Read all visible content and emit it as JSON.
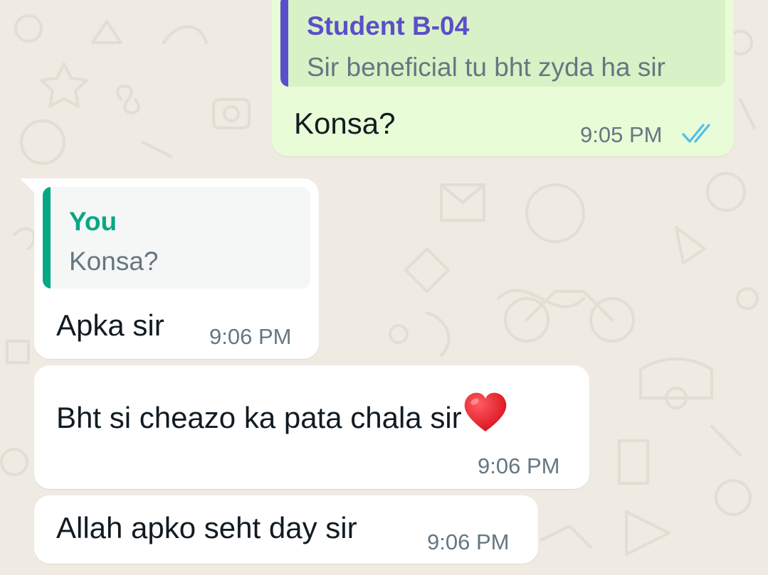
{
  "colors": {
    "wallpaper": "#efeae2",
    "outgoing_bubble": "#e7fcd7",
    "outgoing_quote_bg": "#d9f1c6",
    "incoming_bubble": "#ffffff",
    "incoming_quote_bg": "#f5f6f6",
    "quote_author_purple": "#5b4fc9",
    "quote_author_green": "#06a884",
    "read_ticks": "#53bdeb",
    "heart": "#e8202a"
  },
  "messages": [
    {
      "direction": "outgoing",
      "quoted_author": "Student B-04",
      "quoted_text": "Sir beneficial tu bht zyda ha sir",
      "text": "Konsa?",
      "time": "9:05 PM",
      "status_icon": "double-check-read-icon"
    },
    {
      "direction": "incoming",
      "quoted_author": "You",
      "quoted_text": "Konsa?",
      "text": "Apka sir",
      "time": "9:06 PM"
    },
    {
      "direction": "incoming",
      "text": "Bht si cheazo ka pata chala sir",
      "emoji": "red-heart-emoji",
      "time": "9:06 PM"
    },
    {
      "direction": "incoming",
      "text": "Allah apko seht day sir",
      "time": "9:06 PM"
    }
  ]
}
